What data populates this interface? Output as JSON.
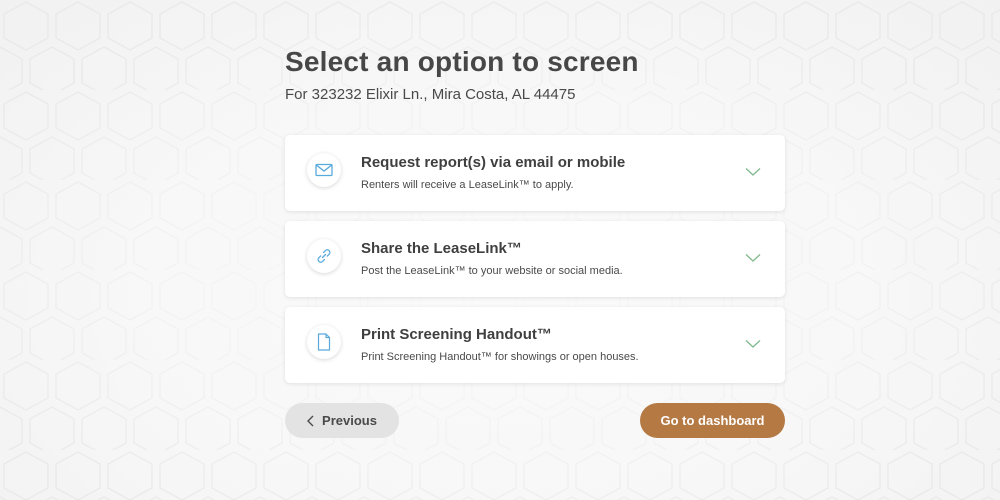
{
  "header": {
    "title": "Select an option to screen",
    "subtitle": "For 323232 Elixir Ln., Mira Costa, AL 44475"
  },
  "options": [
    {
      "icon": "envelope-icon",
      "title": "Request report(s) via email or mobile",
      "description": "Renters will receive a LeaseLink™ to apply."
    },
    {
      "icon": "link-icon",
      "title": "Share the LeaseLink™",
      "description": "Post the LeaseLink™ to your website or social media."
    },
    {
      "icon": "document-icon",
      "title": "Print Screening Handout™",
      "description": "Print Screening Handout™ for showings or open houses."
    }
  ],
  "footer": {
    "previous_label": "Previous",
    "dashboard_label": "Go to dashboard"
  },
  "colors": {
    "accent": "#b57a44",
    "icon_blue": "#5aa9dd",
    "chevron_green": "#7fb98c",
    "secondary_button": "#e3e3e3"
  }
}
